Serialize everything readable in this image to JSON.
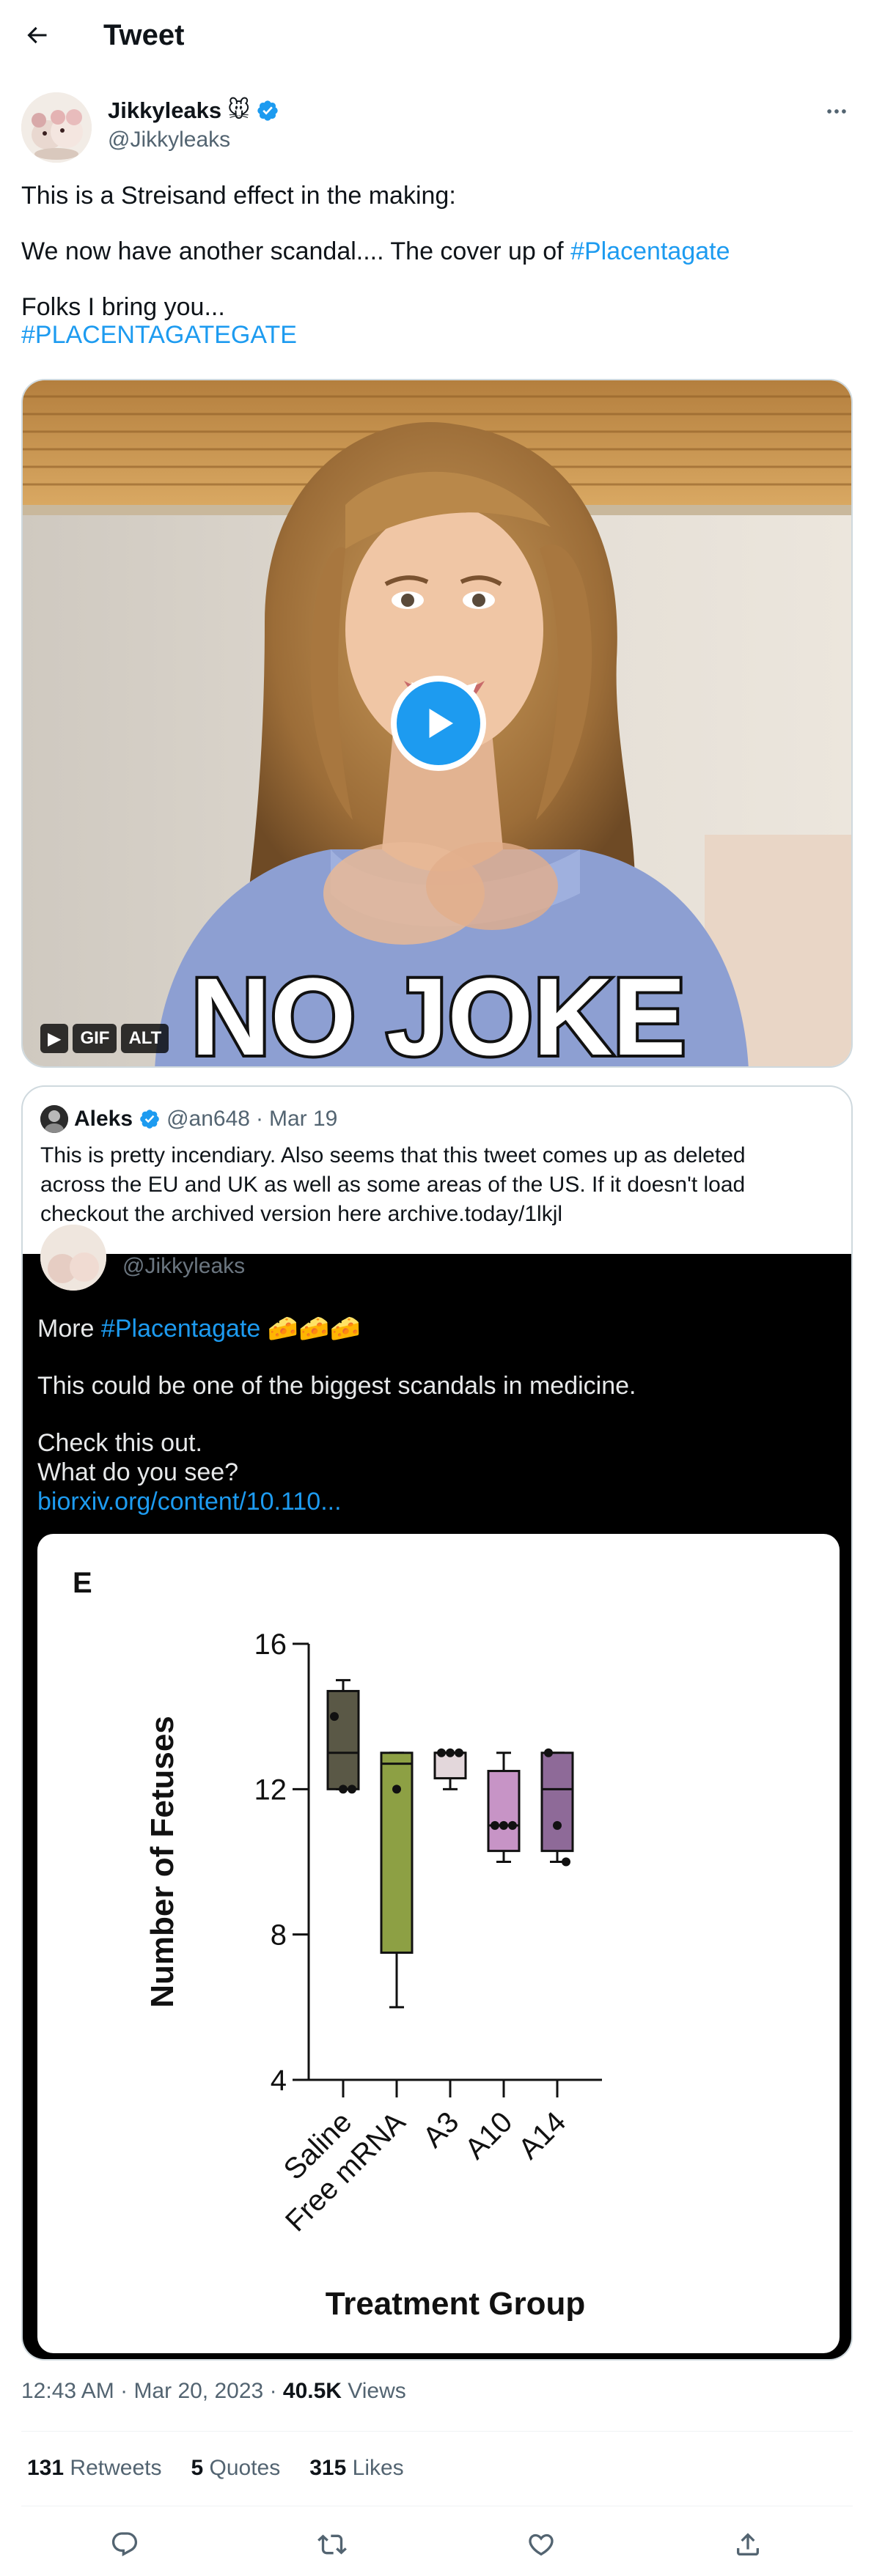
{
  "header": {
    "title": "Tweet"
  },
  "author": {
    "name": "Jikkyleaks",
    "emoji": "🐭",
    "handle": "@Jikkyleaks"
  },
  "tweet": {
    "line1": "This is a Streisand effect in the making:",
    "line2_prefix": "We now have another scandal.... The cover up of ",
    "line2_hashtag": "#Placentagate",
    "line3": "Folks I bring you...",
    "line4_hashtag": "#PLACENTAGATEGATE"
  },
  "media": {
    "caption": "NO JOKE",
    "badge_play": "▶",
    "badge_gif": "GIF",
    "badge_alt": "ALT"
  },
  "quote": {
    "name": "Aleks",
    "handle": "@an648",
    "date": "Mar 19",
    "text_line1": "This is pretty incendiary. Also seems that this tweet comes up as deleted",
    "text_line2": "across the EU and UK as well as some areas of the US. If it doesn't load",
    "text_line3": "checkout the archived version here archive.today/1lkjl",
    "screenshot": {
      "handle": "@Jikkyleaks",
      "line1_prefix": "More ",
      "line1_hashtag": "#Placentagate",
      "line1_emoji": "🧀🧀🧀",
      "line2": "This could be one of the biggest scandals in medicine.",
      "line3": "Check this out.",
      "line4": "What do you see?",
      "link": "biorxiv.org/content/10.110..."
    }
  },
  "chart_data": {
    "type": "box",
    "panel_label": "E",
    "xlabel": "Treatment Group",
    "ylabel": "Number of Fetuses",
    "ylim": [
      4,
      16
    ],
    "yticks": [
      4,
      8,
      12,
      16
    ],
    "categories": [
      "Saline",
      "Free mRNA",
      "A3",
      "A10",
      "A14"
    ],
    "colors": [
      "#5a5846",
      "#8da044",
      "#e3d7db",
      "#c794c6",
      "#8e6a98"
    ],
    "boxes": [
      {
        "name": "Saline",
        "min": 12,
        "q1": 12,
        "median": 13,
        "q3": 14.7,
        "max": 15,
        "points": [
          14,
          12,
          12
        ]
      },
      {
        "name": "Free mRNA",
        "min": 6,
        "q1": 7.5,
        "median": 12.7,
        "q3": 13,
        "max": 13,
        "points": [
          12
        ]
      },
      {
        "name": "A3",
        "min": 12,
        "q1": 12.3,
        "median": 13,
        "q3": 13,
        "max": 13,
        "points": [
          13,
          13,
          13
        ]
      },
      {
        "name": "A10",
        "min": 10,
        "q1": 10.3,
        "median": 11,
        "q3": 12.5,
        "max": 13,
        "points": [
          11,
          11,
          11
        ]
      },
      {
        "name": "A14",
        "min": 10,
        "q1": 10.3,
        "median": 12,
        "q3": 13,
        "max": 13,
        "points": [
          13,
          11,
          10
        ]
      }
    ]
  },
  "footer": {
    "time": "12:43 AM",
    "date": "Mar 20, 2023",
    "views_count": "40.5K",
    "views_label": "Views",
    "retweets_count": "131",
    "retweets_label": "Retweets",
    "quotes_count": "5",
    "quotes_label": "Quotes",
    "likes_count": "315",
    "likes_label": "Likes"
  },
  "colors": {
    "accent": "#1d9bf0",
    "text": "#0f1419",
    "muted": "#536471",
    "border": "#cfd9de"
  },
  "icons": {
    "back": "arrow-left-icon",
    "verified": "verified-badge-icon",
    "more": "more-horizontal-icon",
    "reply": "reply-icon",
    "retweet": "retweet-icon",
    "like": "heart-icon",
    "share": "share-icon"
  }
}
